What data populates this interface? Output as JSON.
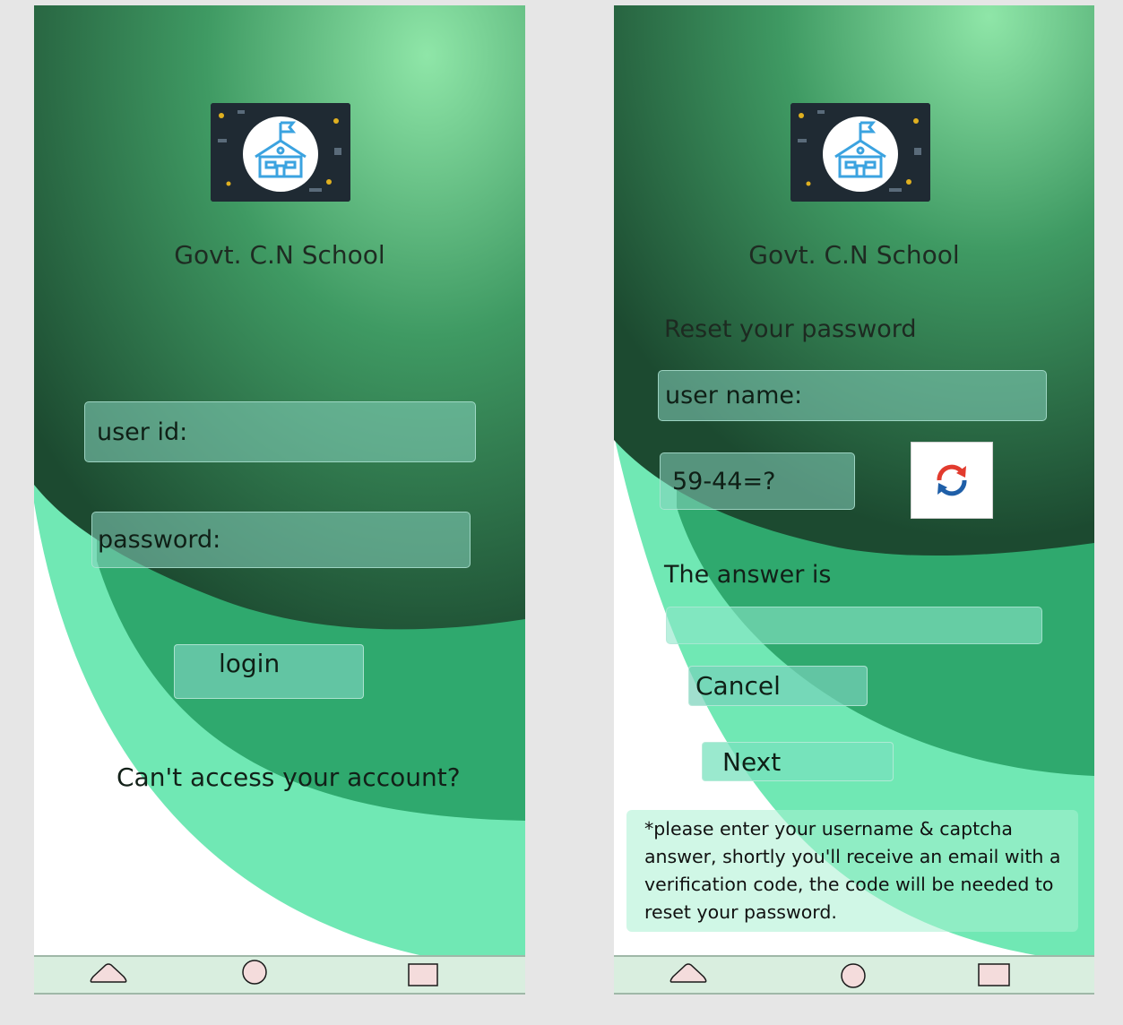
{
  "login_screen": {
    "school_name": "Govt. C.N School",
    "user_id_label": "user id:",
    "password_label": "password:",
    "login_label": "login",
    "cant_access_text": "Can't access your account?"
  },
  "reset_screen": {
    "school_name": "Govt. C.N School",
    "heading": "Reset your password",
    "user_name_label": "user name:",
    "captcha_question": "59-44=?",
    "answer_label": "The answer is",
    "answer_value": "",
    "cancel_label": "Cancel",
    "next_label": "Next",
    "note": "*please enter your username & captcha answer, shortly you'll receive an email with a verification code, the code will be needed to reset your password."
  },
  "nav_icons": [
    "back-triangle-icon",
    "home-circle-icon",
    "recents-square-icon"
  ],
  "colors": {
    "dark_green": "#215a3a",
    "mid_green": "#2fa96e",
    "light_green": "#70e8b4",
    "highlight": "#8fe6a8",
    "navbar": "#d9eedf",
    "nav_icon_fill": "#f4dcdc"
  }
}
